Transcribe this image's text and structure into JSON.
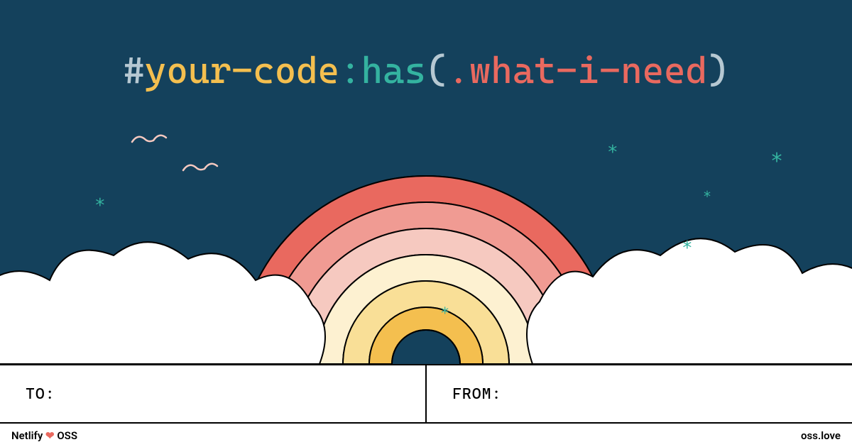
{
  "headline": {
    "hash": "#",
    "selector_id": "your-code",
    "pseudo_colon": ":",
    "pseudo_name": "has",
    "paren_open": "(",
    "dot": ".",
    "class_name": "what-i-need",
    "paren_close": ")"
  },
  "card": {
    "to_label": "TO:",
    "from_label": "FROM:"
  },
  "footer": {
    "brand_prefix": "Netlify",
    "heart": "❤︎",
    "brand_suffix": "OSS",
    "url": "oss.love"
  },
  "colors": {
    "background": "#14415c",
    "blue": "#b6c8d2",
    "yellow": "#f4bf4f",
    "teal": "#34b3a0",
    "coral": "#e9695f",
    "rainbow": [
      "#e9695f",
      "#f09b93",
      "#f6c9c0",
      "#fdf1d1",
      "#f9df97",
      "#f4bf4f"
    ]
  },
  "stars": [
    "*",
    "*",
    "*",
    "*",
    "*",
    "*"
  ]
}
